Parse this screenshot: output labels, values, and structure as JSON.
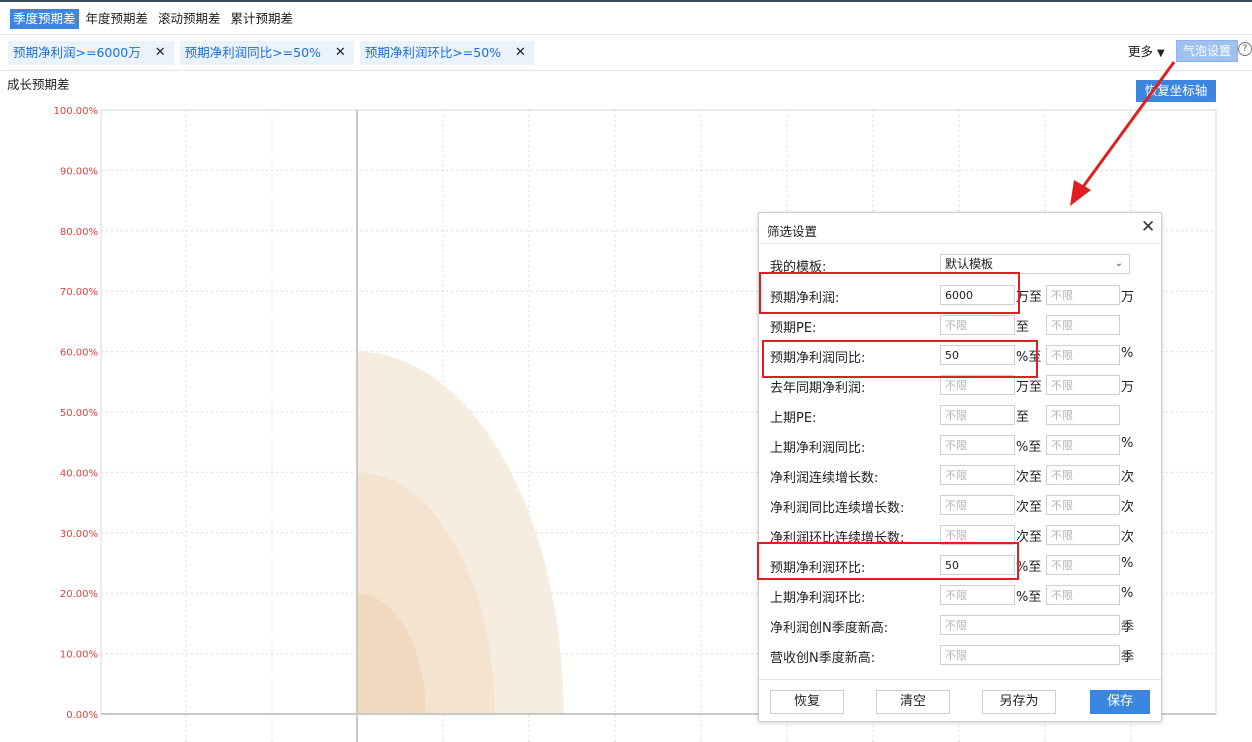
{
  "tabs": [
    {
      "label": "季度预期差",
      "active": true
    },
    {
      "label": "年度预期差",
      "active": false
    },
    {
      "label": "滚动预期差",
      "active": false
    },
    {
      "label": "累计预期差",
      "active": false
    }
  ],
  "chips": [
    {
      "label": "预期净利润>=6000万",
      "close": "✕"
    },
    {
      "label": "预期净利润同比>=50%",
      "close": "✕"
    },
    {
      "label": "预期净利润环比>=50%",
      "close": "✕"
    }
  ],
  "toolbar": {
    "more_label": "更多",
    "bubble_settings_label": "气泡设置",
    "help_glyph": "?",
    "restore_axis_label": "恢复坐标轴"
  },
  "chart_title": "成长预期差",
  "chart_data": {
    "type": "scatter",
    "y_ticks": [
      "100.00%",
      "90.00%",
      "80.00%",
      "70.00%",
      "60.00%",
      "50.00%",
      "40.00%",
      "30.00%",
      "20.00%",
      "10.00%",
      "0.00%"
    ],
    "ylim": [
      0,
      100
    ],
    "grid": true,
    "tick_color": "#e0403a",
    "band_colors": [
      "#f7ece0",
      "#f3e3cf",
      "#efdac0"
    ]
  },
  "dialog": {
    "title": "筛选设置",
    "close_glyph": "✕",
    "template_label": "我的模板:",
    "template_value": "默认模板",
    "rows": [
      {
        "label": "预期净利润:",
        "from": "6000",
        "unit1": "万至",
        "to_placeholder": "不限",
        "unit2": "万",
        "highlight": true
      },
      {
        "label": "预期PE:",
        "from_placeholder": "不限",
        "unit1": "至",
        "to_placeholder": "不限",
        "unit2": ""
      },
      {
        "label": "预期净利润同比:",
        "from": "50",
        "unit1": "%至",
        "to_placeholder": "不限",
        "unit2": "%",
        "highlight": true
      },
      {
        "label": "去年同期净利润:",
        "from_placeholder": "不限",
        "unit1": "万至",
        "to_placeholder": "不限",
        "unit2": "万"
      },
      {
        "label": "上期PE:",
        "from_placeholder": "不限",
        "unit1": "至",
        "to_placeholder": "不限",
        "unit2": ""
      },
      {
        "label": "上期净利润同比:",
        "from_placeholder": "不限",
        "unit1": "%至",
        "to_placeholder": "不限",
        "unit2": "%"
      },
      {
        "label": "净利润连续增长数:",
        "from_placeholder": "不限",
        "unit1": "次至",
        "to_placeholder": "不限",
        "unit2": "次"
      },
      {
        "label": "净利润同比连续增长数:",
        "from_placeholder": "不限",
        "unit1": "次至",
        "to_placeholder": "不限",
        "unit2": "次"
      },
      {
        "label": "净利润环比连续增长数:",
        "from_placeholder": "不限",
        "unit1": "次至",
        "to_placeholder": "不限",
        "unit2": "次"
      },
      {
        "label": "预期净利润环比:",
        "from": "50",
        "unit1": "%至",
        "to_placeholder": "不限",
        "unit2": "%",
        "highlight": true
      },
      {
        "label": "上期净利润环比:",
        "from_placeholder": "不限",
        "unit1": "%至",
        "to_placeholder": "不限",
        "unit2": "%"
      }
    ],
    "single_rows": [
      {
        "label": "净利润创N季度新高:",
        "placeholder": "不限",
        "unit": "季"
      },
      {
        "label": "营收创N季度新高:",
        "placeholder": "不限",
        "unit": "季"
      }
    ],
    "buttons": {
      "restore": "恢复",
      "clear": "清空",
      "save_as": "另存为",
      "save": "保存"
    }
  },
  "colors": {
    "accent": "#3d86e0",
    "chip_bg": "#eaf2fc",
    "annotation_red": "#e02020"
  }
}
